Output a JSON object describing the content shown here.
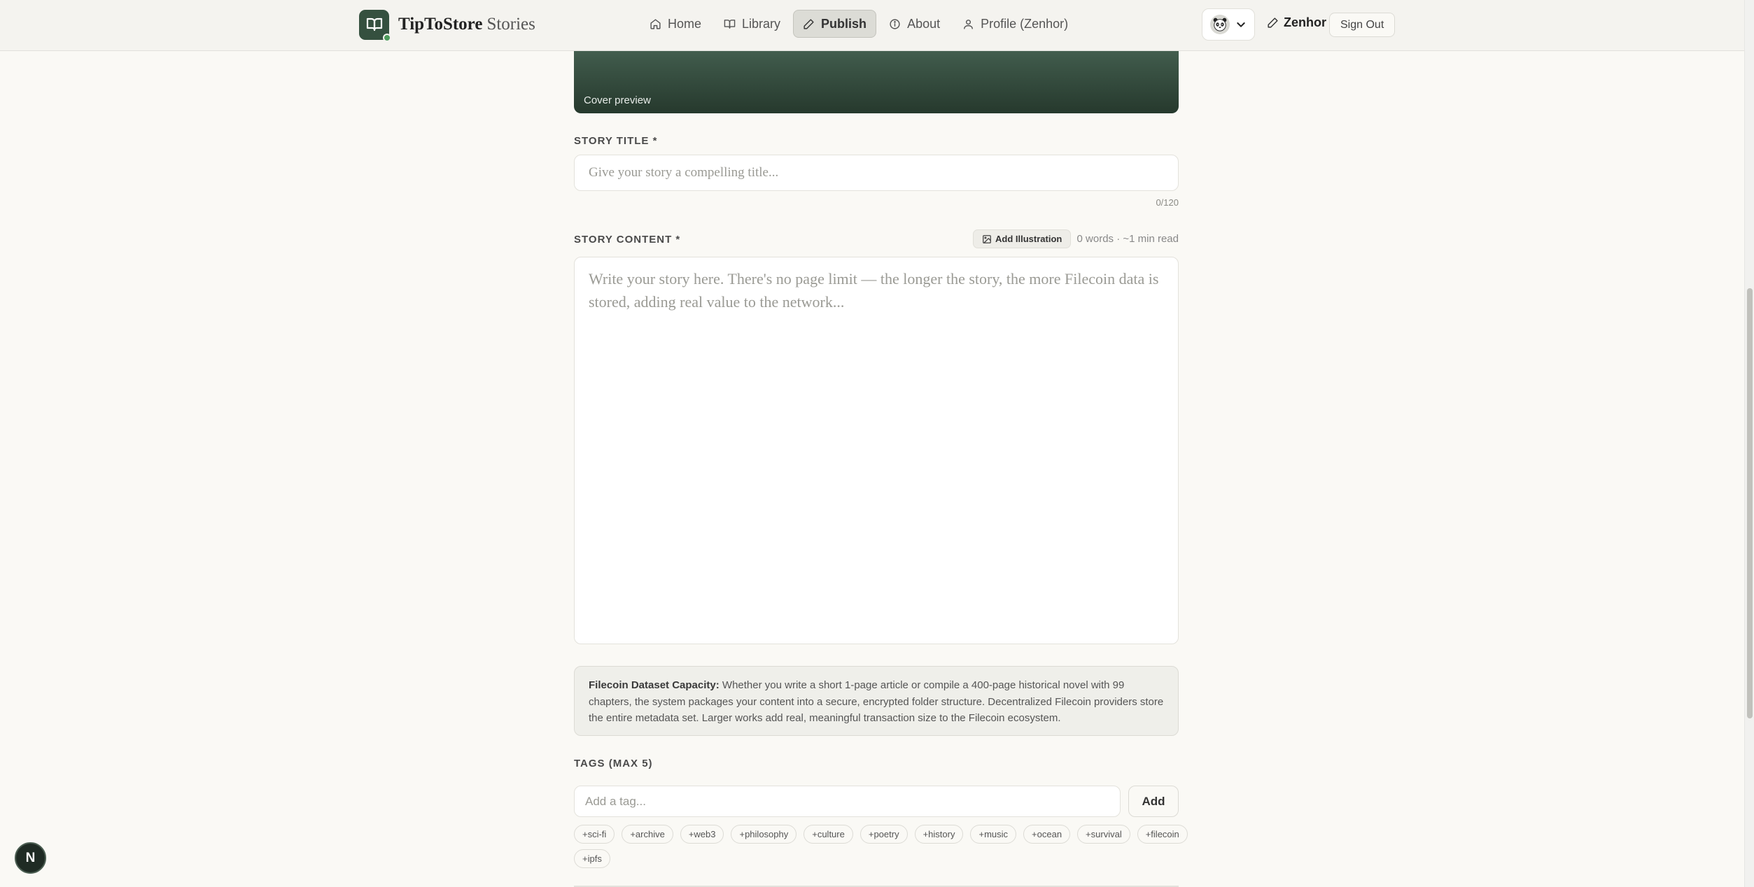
{
  "brand": {
    "name_bold": "TipToStore",
    "name_light": "Stories"
  },
  "nav": {
    "items": [
      {
        "label": "Home",
        "icon": "home-icon"
      },
      {
        "label": "Library",
        "icon": "book-icon"
      },
      {
        "label": "Publish",
        "icon": "pencil-icon",
        "active": true
      },
      {
        "label": "About",
        "icon": "info-icon"
      },
      {
        "label": "Profile (Zenhor)",
        "icon": "user-icon"
      }
    ]
  },
  "user": {
    "name": "Zenhor",
    "avatar_icon": "panda-icon",
    "sign_out_label": "Sign Out"
  },
  "cover": {
    "label": "Cover preview"
  },
  "title_field": {
    "label": "STORY TITLE *",
    "placeholder": "Give your story a compelling title...",
    "value": "",
    "char_count": "0/120"
  },
  "content_field": {
    "label": "STORY CONTENT *",
    "add_illustration_label": "Add Illustration",
    "word_count": "0 words · ~1 min read",
    "placeholder": "Write your story here. There's no page limit — the longer the story, the more Filecoin data is stored, adding real value to the network...",
    "value": ""
  },
  "capacity_note": {
    "title": "Filecoin Dataset Capacity:",
    "text": "Whether you write a short 1-page article or compile a 400-page historical novel with 99 chapters, the system packages your content into a secure, encrypted folder structure. Decentralized Filecoin providers store the entire metadata set. Larger works add real, meaningful transaction size to the Filecoin ecosystem."
  },
  "tags": {
    "label": "TAGS (MAX 5)",
    "placeholder": "Add a tag...",
    "add_label": "Add",
    "suggestions": [
      "+sci-fi",
      "+archive",
      "+web3",
      "+philosophy",
      "+culture",
      "+poetry",
      "+history",
      "+music",
      "+ocean",
      "+survival",
      "+filecoin",
      "+ipfs"
    ]
  },
  "floating_badge": {
    "letter": "N"
  },
  "colors": {
    "background": "#faf9f5",
    "brand_green": "#35503f",
    "active_nav_bg": "#dcdcd6"
  }
}
